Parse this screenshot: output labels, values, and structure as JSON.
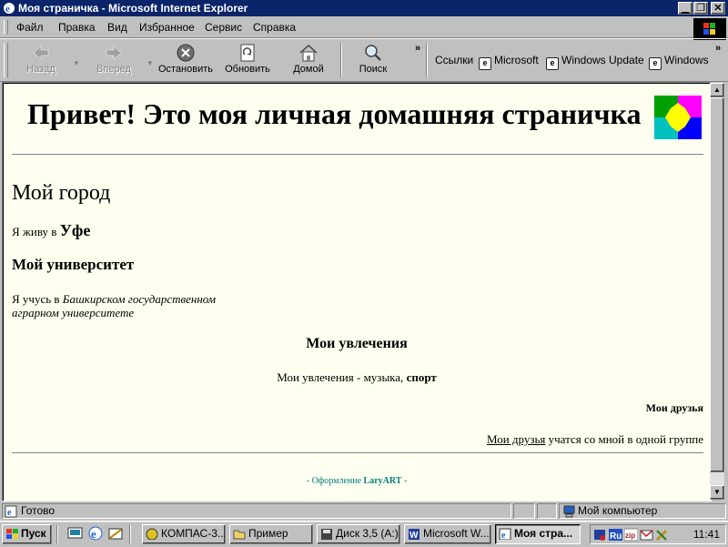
{
  "window": {
    "title": "Моя страничка - Microsoft Internet Explorer"
  },
  "menu": [
    "Файл",
    "Правка",
    "Вид",
    "Избранное",
    "Сервис",
    "Справка"
  ],
  "toolbar": {
    "back": "Назад",
    "forward": "Вперед",
    "stop": "Остановить",
    "refresh": "Обновить",
    "home": "Домой",
    "search": "Поиск",
    "links_label": "Ссылки",
    "links": [
      "Microsoft",
      "Windows Update",
      "Windows"
    ]
  },
  "page": {
    "heading": "Привет! Это моя личная домашняя страничка",
    "city_heading": "Мой город",
    "live_prefix": "Я живу в",
    "city": "Уфе",
    "uni_heading": "Мой университет",
    "study_prefix": "Я учусь в",
    "study_uni": "Башкирском государственном аграрном университете",
    "hobbies_heading": "Мои увлечения",
    "hobbies_prefix": "Мои увлечения - музыка,",
    "hobbies_bold": "спорт",
    "friends_heading": "Мои друзья",
    "friends_link": "Мои друзья",
    "friends_suffix": "учатся со мной в одной группе",
    "footer_prefix": "- Оформление",
    "footer_brand": "LaryART",
    "footer_suffix": "-"
  },
  "status": {
    "text": "Готово",
    "zone": "Мой компьютер"
  },
  "taskbar": {
    "start": "Пуск",
    "tasks": [
      "КОМПАС-3...",
      "Пример",
      "Диск 3,5 (A:)",
      "Microsoft W...",
      "Моя стра..."
    ],
    "clock": "11:41"
  }
}
